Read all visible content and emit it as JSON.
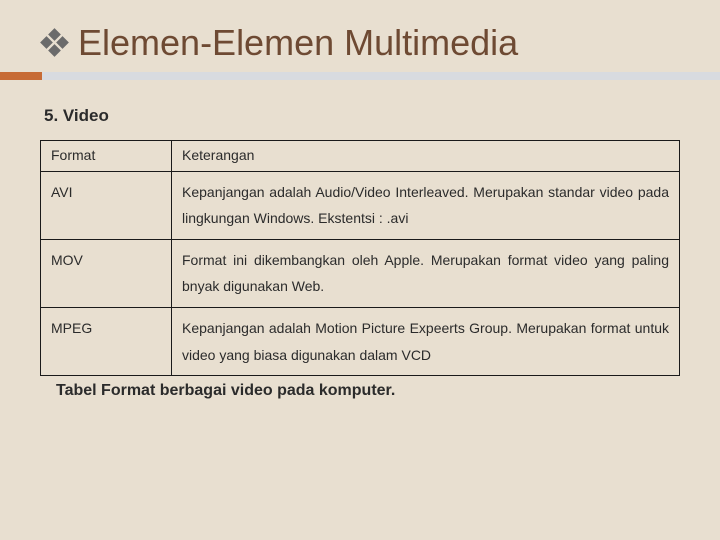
{
  "title": "Elemen-Elemen Multimedia",
  "subhead": "5.  Video",
  "table": {
    "header": {
      "c0": "Format",
      "c1": "Keterangan"
    },
    "rows": [
      {
        "c0": "AVI",
        "c1": "Kepanjangan adalah Audio/Video Interleaved. Merupakan standar video pada lingkungan Windows. Ekstentsi : .avi"
      },
      {
        "c0": "MOV",
        "c1": "Format ini dikembangkan oleh Apple. Merupakan format video yang paling bnyak digunakan Web."
      },
      {
        "c0": "MPEG",
        "c1": "Kepanjangan adalah Motion Picture Expeerts Group. Merupakan format untuk video yang biasa digunakan dalam VCD"
      }
    ]
  },
  "caption": "Tabel Format berbagai video pada komputer."
}
